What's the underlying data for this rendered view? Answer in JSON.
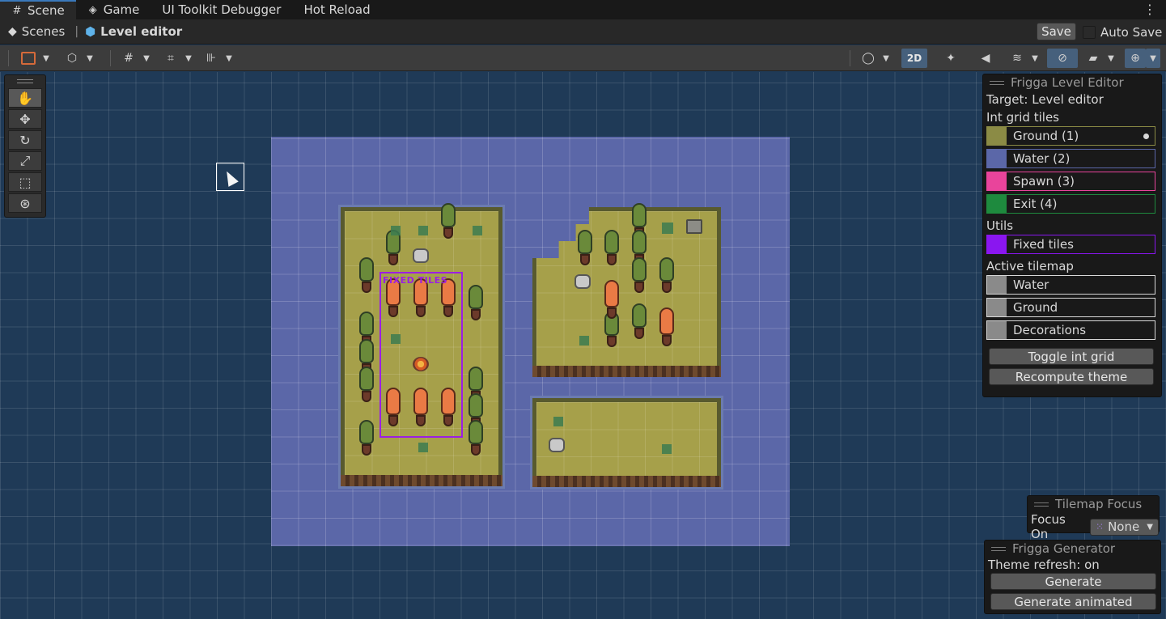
{
  "tabs": [
    {
      "label": "Scene",
      "icon": "hash-icon",
      "active": true
    },
    {
      "label": "Game",
      "icon": "gamepad-icon",
      "active": false
    },
    {
      "label": "UI Toolkit Debugger",
      "icon": "",
      "active": false
    },
    {
      "label": "Hot Reload",
      "icon": "",
      "active": false
    }
  ],
  "breadcrumb": {
    "root": "Scenes",
    "current": "Level editor"
  },
  "header": {
    "save_label": "Save",
    "autosave_label": "Auto Save",
    "autosave_checked": false
  },
  "toolbar": {
    "mode_2d_label": "2D",
    "mode_2d_active": true
  },
  "scene": {
    "fixed_tiles_label": "FIXED TILES"
  },
  "level_editor": {
    "title": "Frigga Level Editor",
    "target": "Target: Level editor",
    "int_grid_label": "Int grid tiles",
    "int_grid_tiles": [
      {
        "name": "Ground (1)",
        "color": "#8b8b45",
        "selected": true
      },
      {
        "name": "Water (2)",
        "color": "#5b67a8",
        "selected": false
      },
      {
        "name": "Spawn (3)",
        "color": "#e9449b",
        "selected": false
      },
      {
        "name": "Exit (4)",
        "color": "#1e8a3e",
        "selected": false
      }
    ],
    "utils_label": "Utils",
    "utils": [
      {
        "name": "Fixed tiles",
        "color": "#8a16f0"
      }
    ],
    "active_tilemap_label": "Active tilemap",
    "tilemaps": [
      {
        "name": "Water",
        "color": "#8a8a8a"
      },
      {
        "name": "Ground",
        "color": "#8a8a8a"
      },
      {
        "name": "Decorations",
        "color": "#8a8a8a"
      }
    ],
    "toggle_label": "Toggle int grid",
    "recompute_label": "Recompute theme"
  },
  "tilemap_focus": {
    "title": "Tilemap Focus",
    "focus_label": "Focus On",
    "focus_value": "None"
  },
  "generator": {
    "title": "Frigga Generator",
    "status": "Theme refresh: on",
    "generate_label": "Generate",
    "generate_animated_label": "Generate animated"
  },
  "colors": {
    "accent": "#3a79bb",
    "fixed_tiles": "#9b1fe2",
    "grass": "#a6a04a",
    "water": "#5b67a8"
  }
}
